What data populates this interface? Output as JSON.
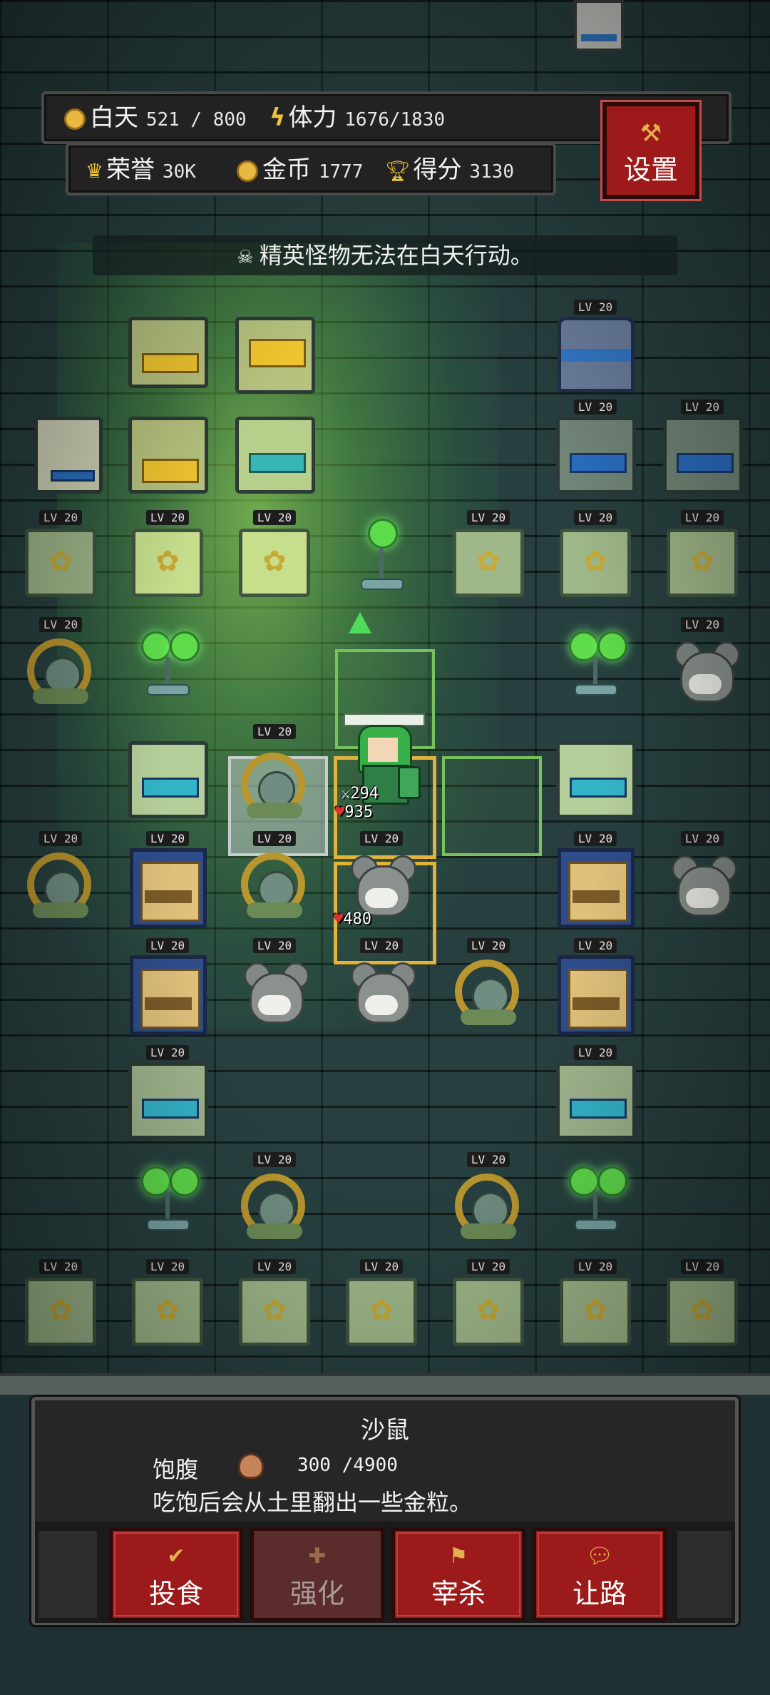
{
  "hud": {
    "day_label": "白天",
    "day_value": "521 / 800",
    "stamina_label": "体力",
    "stamina_value": "1676/1830",
    "honor_label": "荣誉",
    "honor_value": "30K",
    "gold_label": "金币",
    "gold_value": "1777",
    "score_label": "得分",
    "score_value": "3130",
    "settings_label": "设置"
  },
  "message": "精英怪物无法在白天行动。",
  "level_tag": "LV 20",
  "hero": {
    "attack": "294",
    "hp": "935"
  },
  "selected_creature": {
    "hp": "480"
  },
  "info": {
    "name": "沙鼠",
    "hunger_label": "饱腹",
    "hunger_value": "300 /4900",
    "description": "吃饱后会从土里翻出一些金粒。"
  },
  "actions": [
    {
      "label": "投食",
      "icon": "check-icon",
      "enabled": true
    },
    {
      "label": "强化",
      "icon": "plus-icon",
      "enabled": false
    },
    {
      "label": "宰杀",
      "icon": "flag-icon",
      "enabled": true
    },
    {
      "label": "让路",
      "icon": "speech-icon",
      "enabled": true
    }
  ],
  "colors": {
    "accent_red": "#9c1a1a",
    "highlight_gold": "#e2b23d",
    "highlight_green": "#77c25f",
    "heart": "#e03030"
  }
}
